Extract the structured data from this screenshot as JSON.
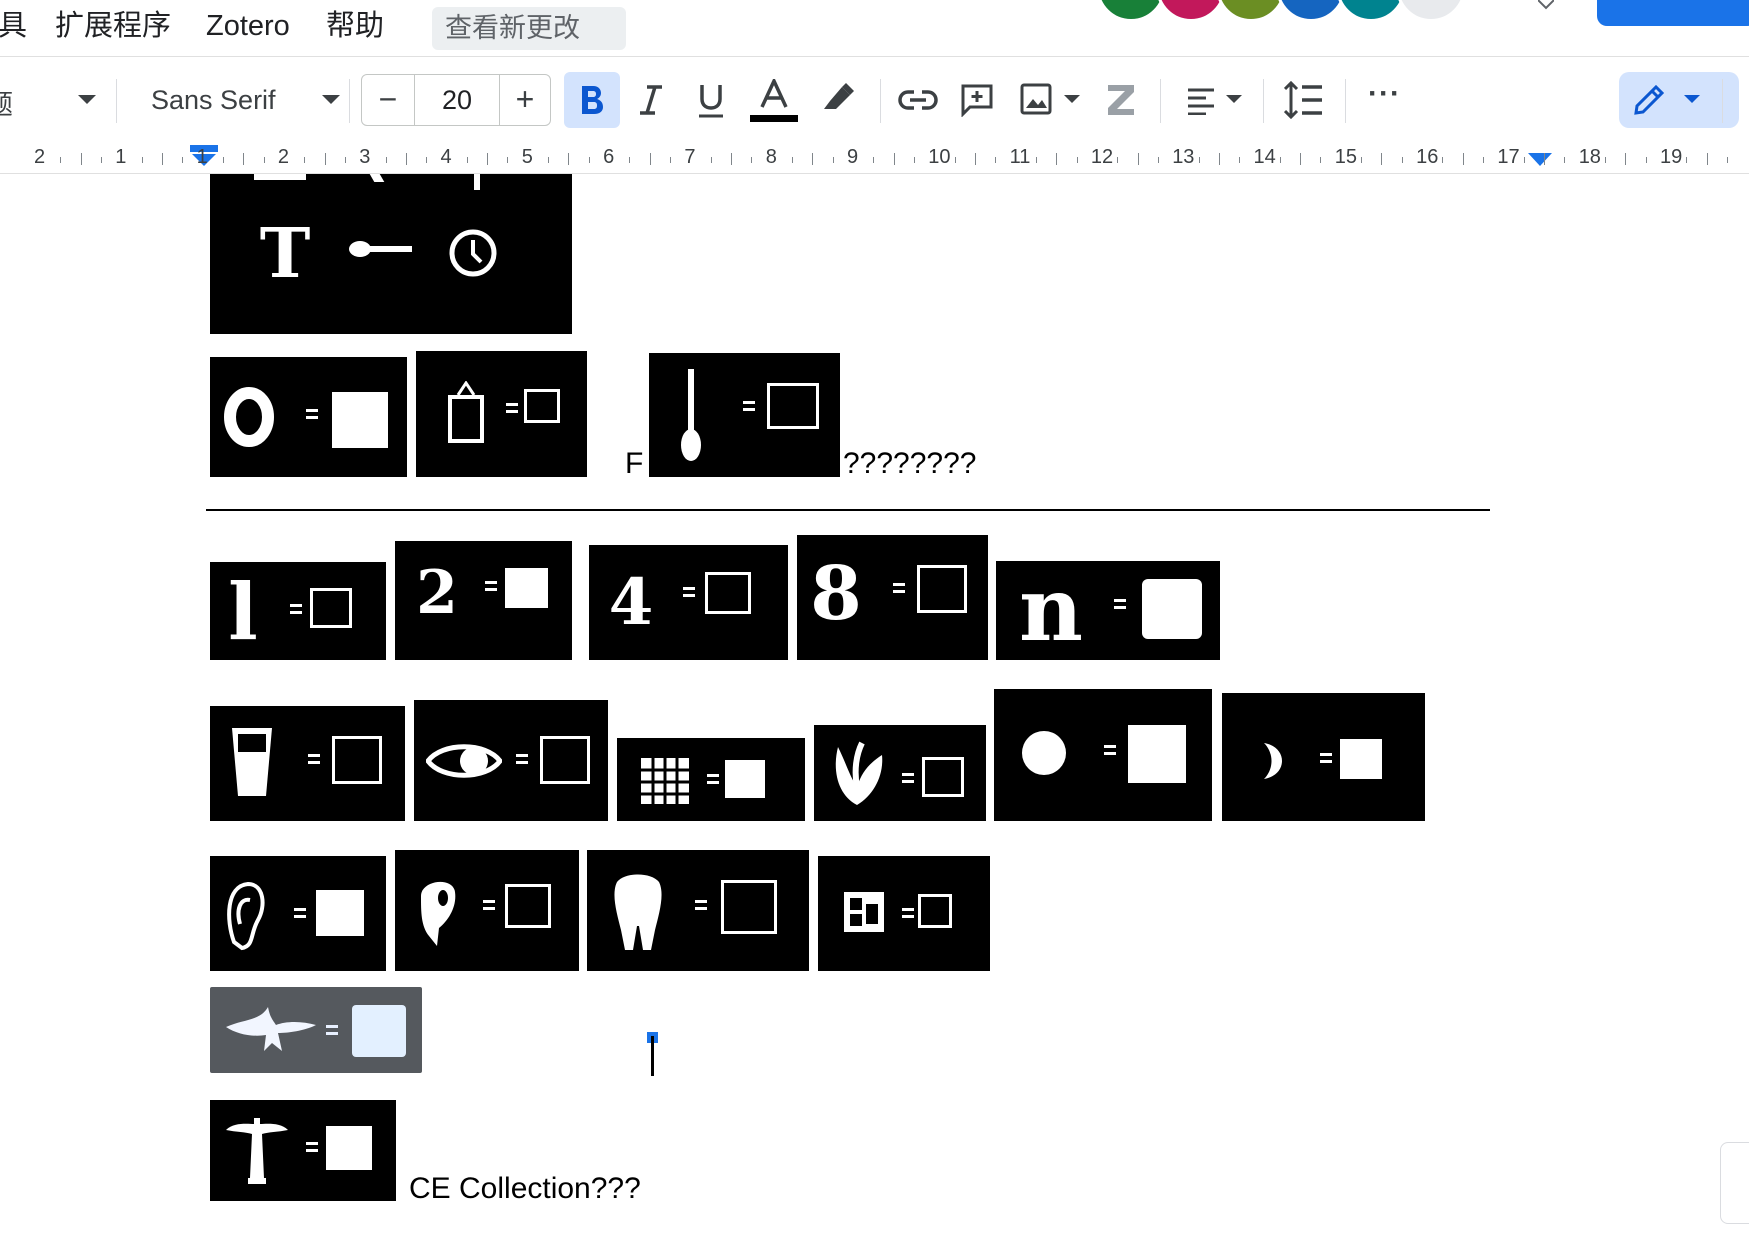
{
  "menu": {
    "items": [
      "具",
      "扩展程序",
      "Zotero",
      "帮助"
    ],
    "whats_new": "查看新更改"
  },
  "toolbar": {
    "style_fragment": "题",
    "font_name": "Sans Serif",
    "font_size": "20",
    "minus": "−",
    "plus": "+",
    "more": "···"
  },
  "ruler": {
    "labels": [
      "2",
      "1",
      "1",
      "2",
      "3",
      "4",
      "5",
      "6",
      "7",
      "8",
      "9",
      "10",
      "11",
      "12",
      "13",
      "14",
      "15",
      "16",
      "17",
      "18",
      "19"
    ]
  },
  "collaborators": [
    "#188038",
    "#c2185b",
    "#6b8e23",
    "#1565c0",
    "#00838f",
    "#e8eaed"
  ],
  "document": {
    "row1_letter": "F",
    "row1_suffix": "????????",
    "glyphs_row2": [
      "l",
      "2",
      "4",
      "8",
      "n"
    ],
    "caption": "CE Collection???"
  }
}
